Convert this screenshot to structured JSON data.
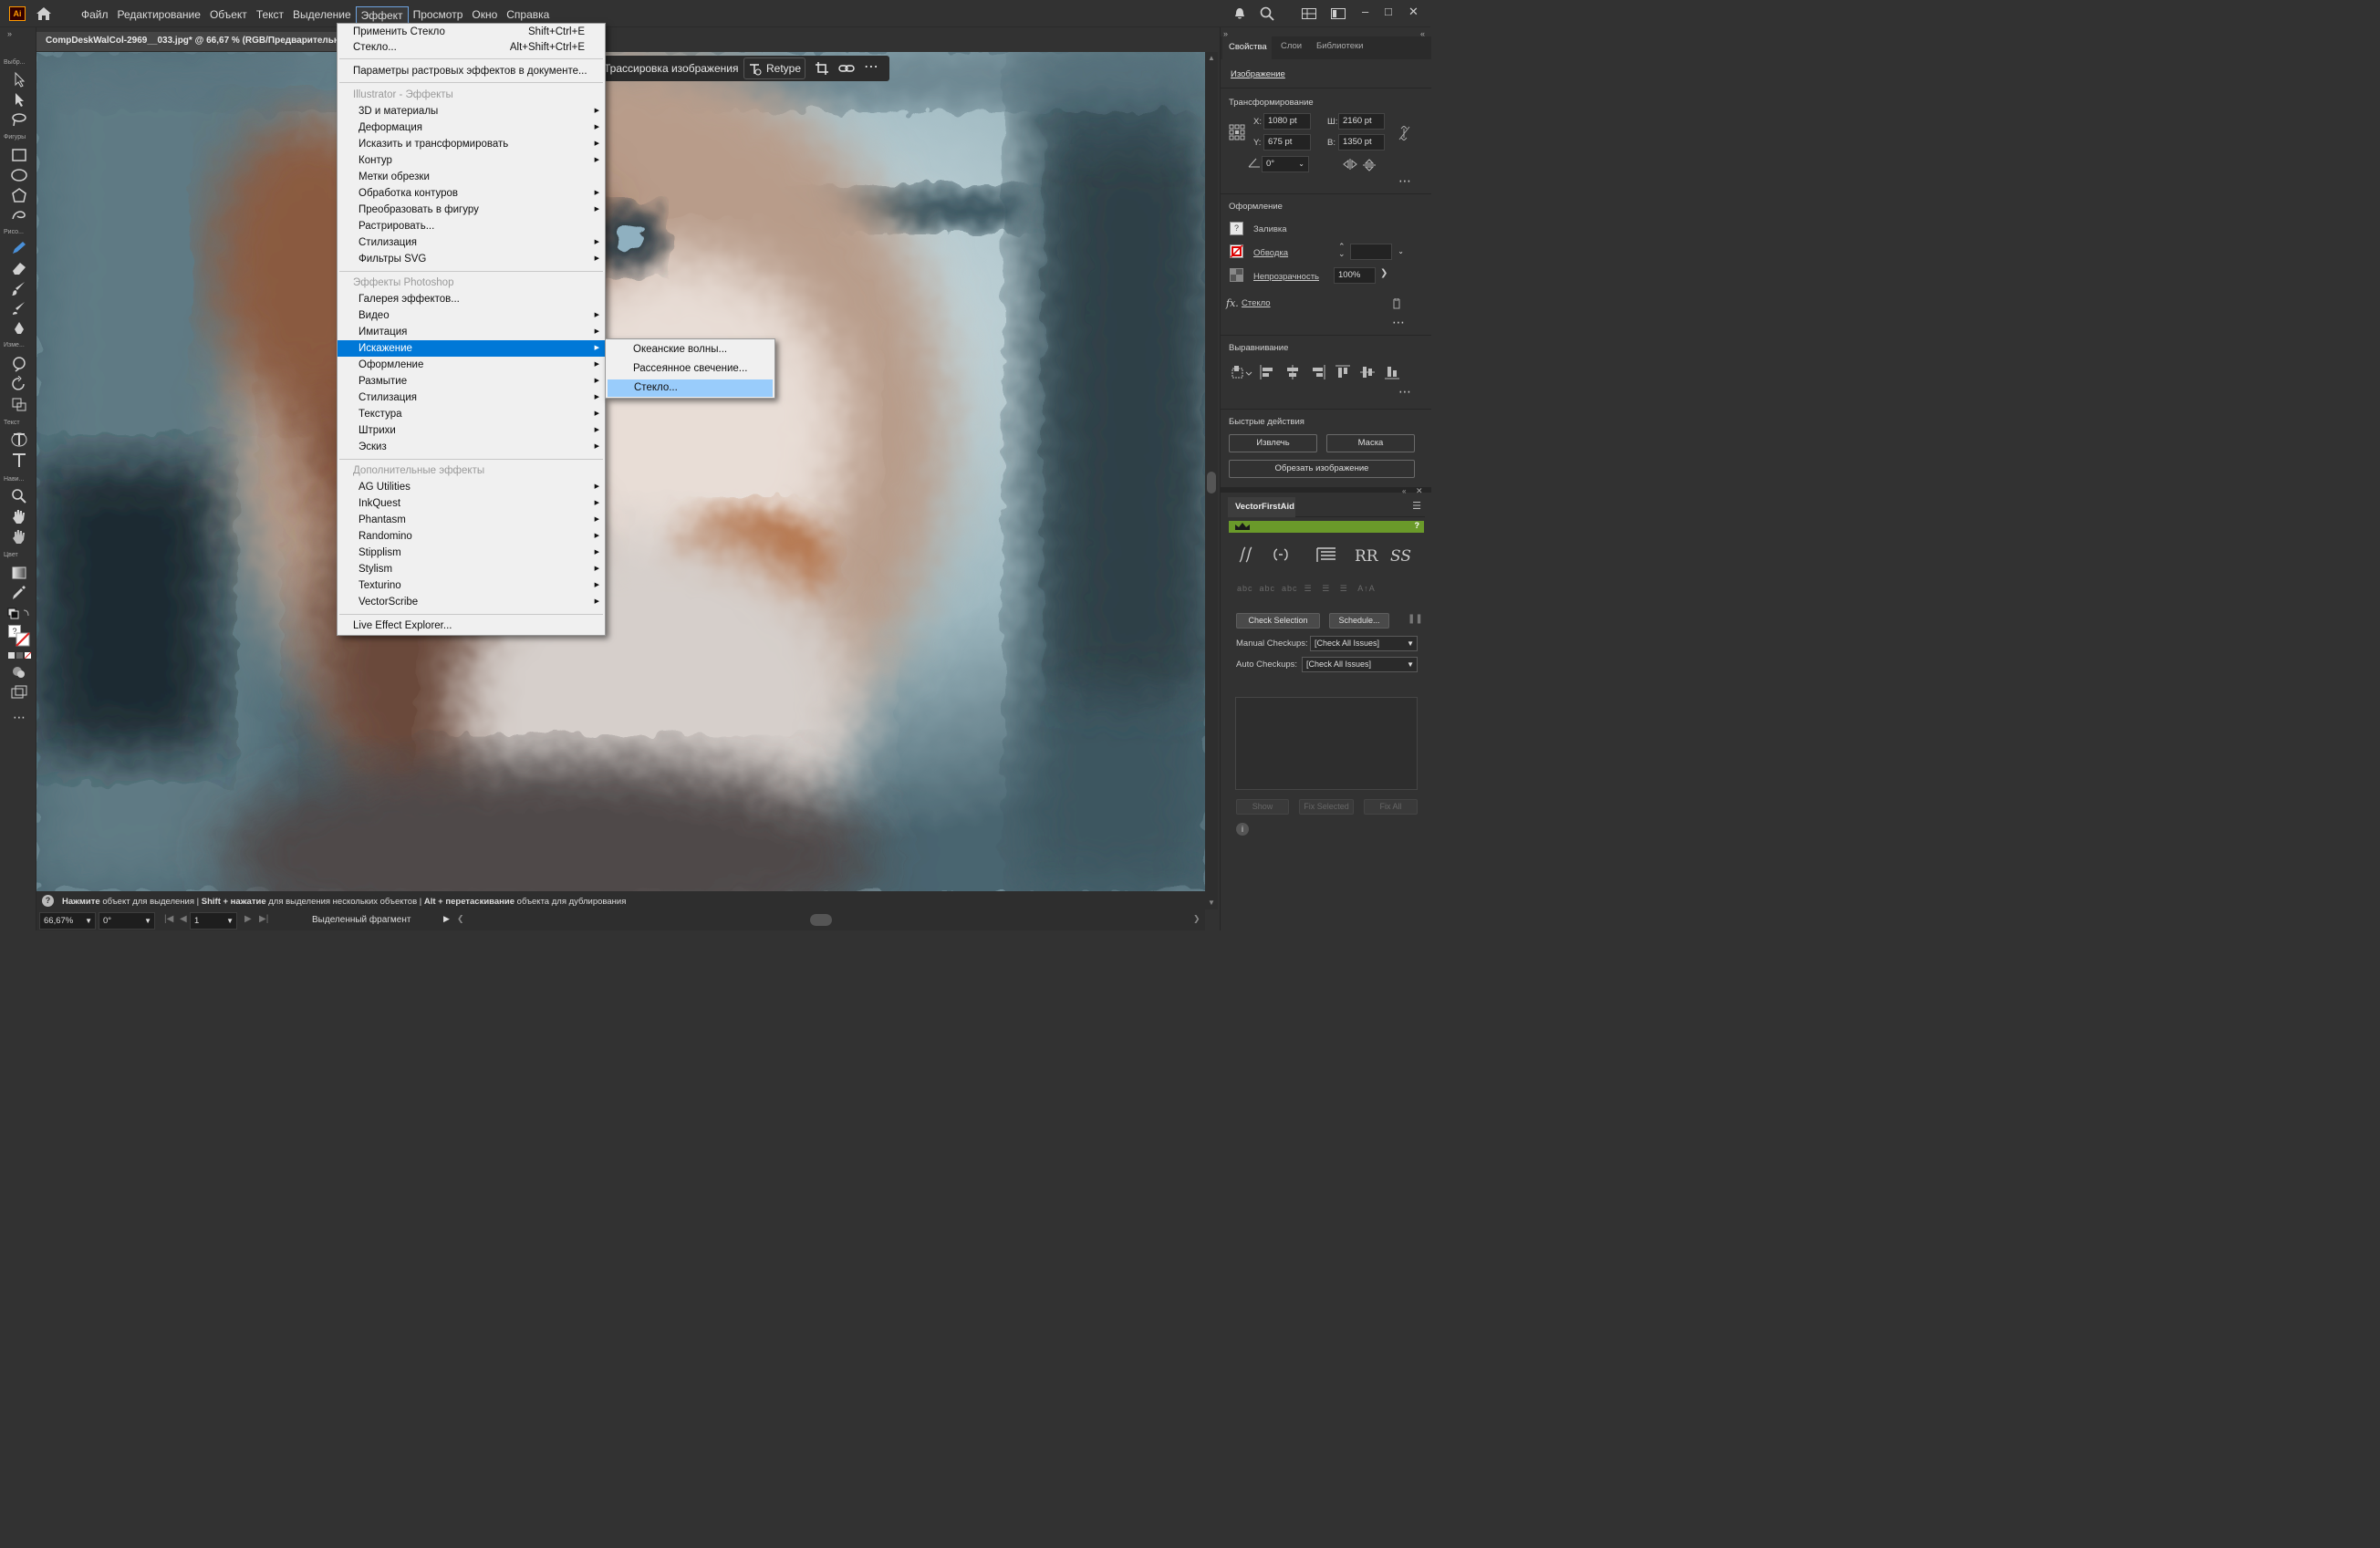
{
  "app": {
    "logo": "Ai"
  },
  "menubar": {
    "items": [
      "Файл",
      "Редактирование",
      "Объект",
      "Текст",
      "Выделение",
      "Эффект",
      "Просмотр",
      "Окно",
      "Справка"
    ],
    "active_index": 5
  },
  "toolbar": {
    "labels": [
      "Выбр...",
      "Фигуры",
      "Рисо...",
      "Изме...",
      "Текст",
      "Нави...",
      "Цвет"
    ]
  },
  "document": {
    "tab_title": "CompDeskWalCol-2969__033.jpg* @ 66,67 % (RGB/Предварительный"
  },
  "context_bar": {
    "trace_label": "Трассировка изображения",
    "retype_label": "Retype"
  },
  "effect_menu": {
    "apply_last": {
      "label": "Применить Стекло",
      "shortcut": "Shift+Ctrl+E"
    },
    "last_effect": {
      "label": "Стекло...",
      "shortcut": "Alt+Shift+Ctrl+E"
    },
    "doc_raster": "Параметры растровых эффектов в документе...",
    "illustrator_header": "Illustrator - Эффекты",
    "illustrator_items": [
      {
        "label": "3D и материалы",
        "sub": true
      },
      {
        "label": "Деформация",
        "sub": true
      },
      {
        "label": "Исказить и трансформировать",
        "sub": true
      },
      {
        "label": "Контур",
        "sub": true
      },
      {
        "label": "Метки обрезки",
        "sub": false
      },
      {
        "label": "Обработка контуров",
        "sub": true
      },
      {
        "label": "Преобразовать в фигуру",
        "sub": true
      },
      {
        "label": "Растрировать...",
        "sub": false
      },
      {
        "label": "Стилизация",
        "sub": true
      },
      {
        "label": "Фильтры SVG",
        "sub": true
      }
    ],
    "photoshop_header": "Эффекты Photoshop",
    "photoshop_items": [
      {
        "label": "Галерея эффектов...",
        "sub": false
      },
      {
        "label": "Видео",
        "sub": true
      },
      {
        "label": "Имитация",
        "sub": true
      },
      {
        "label": "Искажение",
        "sub": true
      },
      {
        "label": "Оформление",
        "sub": true
      },
      {
        "label": "Размытие",
        "sub": true
      },
      {
        "label": "Стилизация",
        "sub": true
      },
      {
        "label": "Текстура",
        "sub": true
      },
      {
        "label": "Штрихи",
        "sub": true
      },
      {
        "label": "Эскиз",
        "sub": true
      }
    ],
    "selected_photoshop_index": 3,
    "extra_header": "Дополнительные эффекты",
    "extra_items": [
      {
        "label": "AG Utilities",
        "sub": true
      },
      {
        "label": "InkQuest",
        "sub": true
      },
      {
        "label": "Phantasm",
        "sub": true
      },
      {
        "label": "Randomino",
        "sub": true
      },
      {
        "label": "Stipplism",
        "sub": true
      },
      {
        "label": "Stylism",
        "sub": true
      },
      {
        "label": "Texturino",
        "sub": true
      },
      {
        "label": "VectorScribe",
        "sub": true
      }
    ],
    "explorer": "Live Effect Explorer..."
  },
  "distort_submenu": {
    "items": [
      "Океанские волны...",
      "Рассеянное свечение...",
      "Стекло..."
    ],
    "highlighted_index": 2
  },
  "statusbar": {
    "hint_parts": [
      "Нажмите",
      " объект для выделения  |  ",
      "Shift + нажатие",
      " для выделения нескольких объектов  |  ",
      "Alt + перетаскивание",
      " объекта для дублирования"
    ]
  },
  "bottombar": {
    "zoom": "66,67%",
    "rotation": "0°",
    "artboard": "1",
    "selection_label": "Выделенный фрагмент"
  },
  "properties_panel": {
    "tabs": [
      "Свойства",
      "Слои",
      "Библиотеки"
    ],
    "object_type": "Изображение",
    "transform": {
      "title": "Трансформирование",
      "x_label": "X:",
      "x": "1080 pt",
      "y_label": "Y:",
      "y": "675 pt",
      "w_label": "Ш:",
      "w": "2160 pt",
      "h_label": "В:",
      "h": "1350 pt",
      "angle": "0°"
    },
    "appearance": {
      "title": "Оформление",
      "fill": "Заливка",
      "stroke": "Обводка",
      "opacity_label": "Непрозрачность",
      "opacity": "100%",
      "effect": "Стекло"
    },
    "align_title": "Выравнивание",
    "quick_actions": {
      "title": "Быстрые действия",
      "extract": "Извлечь",
      "mask": "Маска",
      "crop": "Обрезать изображение"
    }
  },
  "vectorfirstaid": {
    "title": "VectorFirstAid",
    "check_selection": "Check Selection",
    "schedule": "Schedule...",
    "manual_label": "Manual Checkups:",
    "manual_value": "[Check All Issues]",
    "auto_label": "Auto Checkups:",
    "auto_value": "[Check All Issues]",
    "show": "Show",
    "fix_selected": "Fix Selected",
    "fix_all": "Fix All",
    "accent": "#6a9a2a"
  }
}
